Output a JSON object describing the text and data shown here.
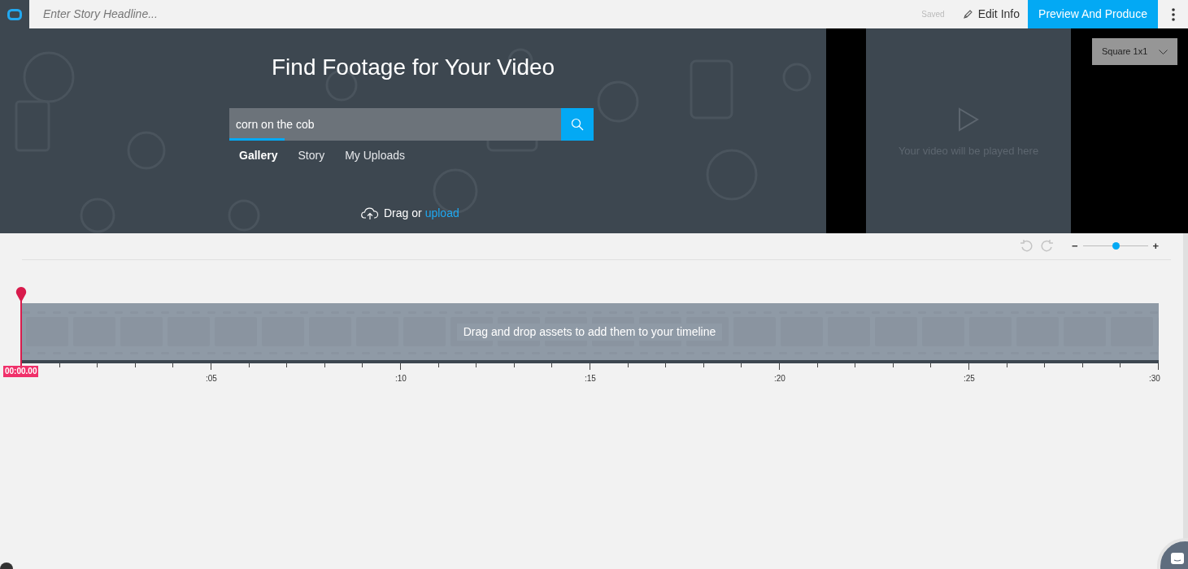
{
  "header": {
    "headline_placeholder": "Enter Story Headline...",
    "saved_label": "Saved",
    "edit_info": "Edit Info",
    "preview_button": "Preview And Produce"
  },
  "search": {
    "heading": "Find Footage for Your Video",
    "query": "corn on the cob",
    "tabs": [
      {
        "label": "Gallery",
        "selected": true
      },
      {
        "label": "Story",
        "selected": false
      },
      {
        "label": "My Uploads",
        "selected": false
      }
    ],
    "drag_text": "Drag or",
    "upload_link": "upload"
  },
  "preview": {
    "aspect_dropdown": "Square 1x1",
    "message": "Your video will be played here"
  },
  "timeline": {
    "zoom": {
      "minus": "−",
      "plus": "+",
      "level": 0.5
    },
    "drop_text": "Drag and drop assets to add them to your timeline",
    "playhead_time": "00:00.00",
    "tick_labels": [
      ":05",
      ":10",
      ":15",
      ":20",
      ":25",
      ":30"
    ]
  }
}
